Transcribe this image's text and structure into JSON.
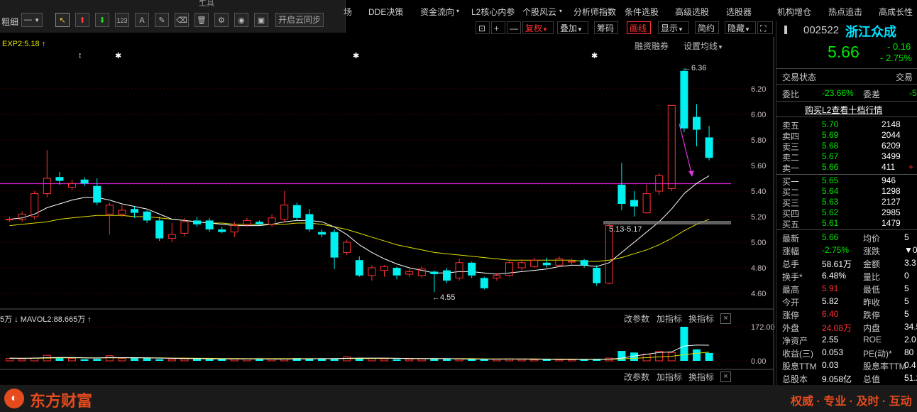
{
  "toolbar": {
    "window_title": "工具",
    "close": "×",
    "thickness_label": "粗细",
    "line_style": "—",
    "cloud_sync_label": "开启云同步",
    "num_icon_label": "123",
    "text_icon_label": "A"
  },
  "menu": [
    "场",
    "DDE决策",
    "资金流向",
    "L2核心内参",
    "个股风云",
    "分析师指数",
    "条件选股",
    "高级选股",
    "选股器",
    "机构增仓",
    "热点追击",
    "高成长性"
  ],
  "menu_dropdown_marks": [
    "▾",
    "▾",
    "▾"
  ],
  "chart_bar": {
    "plus": "+",
    "minus": "—",
    "fuquan": "复权",
    "dieja": "叠加",
    "chouma": "筹码",
    "huaxian": "画线",
    "xianshi": "显示",
    "jianyue": "简约",
    "yincang": "隐藏",
    "expand": "⛶"
  },
  "indicator_label": "EXP2:5.18 ↑",
  "rzrq_label": "融资融券",
  "ma_settings_label": "设置均线",
  "annotations": {
    "high": "←6.36",
    "low": "←4.55",
    "range_label": "5.13-5.17"
  },
  "volume_label": "5万 ↓ MAVOL2:88.665万 ↑",
  "vol_buttons": [
    "改参数",
    "加指标",
    "换指标"
  ],
  "vol_close": "×",
  "bottom_buttons": [
    "改参数",
    "加指标",
    "换指标"
  ],
  "chart_data": {
    "type": "candlestick",
    "y_ticks": [
      "6.20",
      "6.00",
      "5.80",
      "5.60",
      "5.40",
      "5.20",
      "5.00",
      "4.80",
      "4.60"
    ],
    "vol_ticks": [
      "172.00",
      "0.00"
    ],
    "ylim": [
      4.52,
      6.42
    ],
    "candles": [
      {
        "o": 5.18,
        "c": 5.18,
        "h": 5.2,
        "l": 5.16
      },
      {
        "o": 5.18,
        "c": 5.22,
        "h": 5.24,
        "l": 5.16
      },
      {
        "o": 5.2,
        "c": 5.38,
        "h": 5.4,
        "l": 5.18
      },
      {
        "o": 5.38,
        "c": 5.5,
        "h": 5.72,
        "l": 5.35
      },
      {
        "o": 5.51,
        "c": 5.48,
        "h": 5.55,
        "l": 5.45
      },
      {
        "o": 5.43,
        "c": 5.46,
        "h": 5.49,
        "l": 5.41
      },
      {
        "o": 5.49,
        "c": 5.46,
        "h": 5.51,
        "l": 5.44
      },
      {
        "o": 5.44,
        "c": 5.31,
        "h": 5.5,
        "l": 5.29
      },
      {
        "o": 5.22,
        "c": 5.29,
        "h": 5.31,
        "l": 5.06
      },
      {
        "o": 5.22,
        "c": 5.25,
        "h": 5.29,
        "l": 5.2
      },
      {
        "o": 5.26,
        "c": 5.23,
        "h": 5.28,
        "l": 5.19
      },
      {
        "o": 5.24,
        "c": 5.17,
        "h": 5.25,
        "l": 5.15
      },
      {
        "o": 5.17,
        "c": 5.03,
        "h": 5.2,
        "l": 5.01
      },
      {
        "o": 5.03,
        "c": 5.06,
        "h": 5.15,
        "l": 5.0
      },
      {
        "o": 5.07,
        "c": 5.16,
        "h": 5.19,
        "l": 5.05
      },
      {
        "o": 5.17,
        "c": 5.14,
        "h": 5.2,
        "l": 5.12
      },
      {
        "o": 5.17,
        "c": 5.1,
        "h": 5.19,
        "l": 5.08
      },
      {
        "o": 5.1,
        "c": 5.08,
        "h": 5.12,
        "l": 5.07
      },
      {
        "o": 5.08,
        "c": 5.13,
        "h": 5.16,
        "l": 5.04
      },
      {
        "o": 5.14,
        "c": 5.17,
        "h": 5.19,
        "l": 5.12
      },
      {
        "o": 5.16,
        "c": 5.14,
        "h": 5.17,
        "l": 5.13
      },
      {
        "o": 5.14,
        "c": 5.19,
        "h": 5.22,
        "l": 5.12
      },
      {
        "o": 5.18,
        "c": 5.29,
        "h": 5.4,
        "l": 5.16
      },
      {
        "o": 5.29,
        "c": 5.19,
        "h": 5.31,
        "l": 5.17
      },
      {
        "o": 5.22,
        "c": 5.1,
        "h": 5.26,
        "l": 5.08
      },
      {
        "o": 5.08,
        "c": 5.06,
        "h": 5.1,
        "l": 5.04
      },
      {
        "o": 5.08,
        "c": 4.88,
        "h": 5.1,
        "l": 4.79
      },
      {
        "o": 4.92,
        "c": 5.0,
        "h": 5.02,
        "l": 4.9
      },
      {
        "o": 4.86,
        "c": 4.74,
        "h": 4.89,
        "l": 4.73
      },
      {
        "o": 4.74,
        "c": 4.8,
        "h": 4.82,
        "l": 4.7
      },
      {
        "o": 4.78,
        "c": 4.81,
        "h": 4.82,
        "l": 4.73
      },
      {
        "o": 4.8,
        "c": 4.74,
        "h": 4.81,
        "l": 4.71
      },
      {
        "o": 4.75,
        "c": 4.77,
        "h": 4.79,
        "l": 4.73
      },
      {
        "o": 4.74,
        "c": 4.79,
        "h": 4.81,
        "l": 4.72
      },
      {
        "o": 4.77,
        "c": 4.75,
        "h": 4.78,
        "l": 4.61
      },
      {
        "o": 4.78,
        "c": 4.7,
        "h": 4.8,
        "l": 4.68
      },
      {
        "o": 4.72,
        "c": 4.84,
        "h": 4.87,
        "l": 4.7
      },
      {
        "o": 4.84,
        "c": 4.74,
        "h": 4.85,
        "l": 4.72
      },
      {
        "o": 4.72,
        "c": 4.64,
        "h": 4.73,
        "l": 4.63
      },
      {
        "o": 4.72,
        "c": 4.74,
        "h": 4.76,
        "l": 4.7
      },
      {
        "o": 4.74,
        "c": 4.84,
        "h": 4.85,
        "l": 4.73
      },
      {
        "o": 4.8,
        "c": 4.84,
        "h": 4.86,
        "l": 4.78
      },
      {
        "o": 4.81,
        "c": 4.86,
        "h": 4.88,
        "l": 4.8
      },
      {
        "o": 4.84,
        "c": 4.82,
        "h": 4.88,
        "l": 4.8
      },
      {
        "o": 4.82,
        "c": 4.87,
        "h": 4.89,
        "l": 4.81
      },
      {
        "o": 4.85,
        "c": 4.85,
        "h": 4.87,
        "l": 4.82
      },
      {
        "o": 4.86,
        "c": 4.82,
        "h": 4.87,
        "l": 4.8
      },
      {
        "o": 4.8,
        "c": 4.68,
        "h": 4.82,
        "l": 4.66
      },
      {
        "o": 4.68,
        "c": 5.13,
        "h": 5.15,
        "l": 4.67
      },
      {
        "o": 5.45,
        "c": 5.3,
        "h": 5.62,
        "l": 5.25
      },
      {
        "o": 5.33,
        "c": 5.28,
        "h": 5.4,
        "l": 5.2
      },
      {
        "o": 5.23,
        "c": 5.38,
        "h": 5.45,
        "l": 5.22
      },
      {
        "o": 5.4,
        "c": 5.52,
        "h": 5.54,
        "l": 5.37
      },
      {
        "o": 5.42,
        "c": 6.07,
        "h": 6.07,
        "l": 5.4
      },
      {
        "o": 6.34,
        "c": 5.89,
        "h": 6.36,
        "l": 5.86
      },
      {
        "o": 5.98,
        "c": 5.88,
        "h": 6.08,
        "l": 5.75
      },
      {
        "o": 5.82,
        "c": 5.66,
        "h": 5.91,
        "l": 5.64
      }
    ],
    "ma1": [
      5.18,
      5.19,
      5.22,
      5.27,
      5.3,
      5.33,
      5.35,
      5.35,
      5.33,
      5.3,
      5.28,
      5.26,
      5.22,
      5.18,
      5.17,
      5.16,
      5.15,
      5.14,
      5.13,
      5.13,
      5.13,
      5.14,
      5.16,
      5.17,
      5.17,
      5.16,
      5.12,
      5.06,
      4.98,
      4.92,
      4.87,
      4.83,
      4.8,
      4.78,
      4.76,
      4.76,
      4.77,
      4.77,
      4.76,
      4.75,
      4.76,
      4.77,
      4.78,
      4.79,
      4.81,
      4.82,
      4.82,
      4.81,
      4.84,
      4.92,
      5.0,
      5.08,
      5.16,
      5.26,
      5.38,
      5.46,
      5.52
    ],
    "ma2": [
      5.13,
      5.14,
      5.15,
      5.16,
      5.18,
      5.19,
      5.2,
      5.21,
      5.21,
      5.21,
      5.2,
      5.2,
      5.19,
      5.18,
      5.17,
      5.16,
      5.15,
      5.15,
      5.14,
      5.14,
      5.14,
      5.14,
      5.14,
      5.15,
      5.15,
      5.14,
      5.12,
      5.1,
      5.07,
      5.04,
      5.01,
      4.98,
      4.96,
      4.94,
      4.92,
      4.91,
      4.9,
      4.89,
      4.88,
      4.87,
      4.86,
      4.86,
      4.86,
      4.86,
      4.86,
      4.86,
      4.85,
      4.85,
      4.86,
      4.88,
      4.91,
      4.94,
      4.98,
      5.03,
      5.09,
      5.14,
      5.18
    ],
    "volumes": [
      12,
      10,
      14,
      28,
      14,
      12,
      8,
      10,
      26,
      12,
      16,
      14,
      8,
      8,
      10,
      12,
      8,
      10,
      9,
      10,
      8,
      9,
      10,
      14,
      10,
      12,
      9,
      20,
      14,
      12,
      10,
      8,
      9,
      10,
      12,
      10,
      9,
      8,
      7,
      8,
      10,
      8,
      6,
      7,
      6,
      6,
      7,
      10,
      14,
      50,
      42,
      34,
      48,
      42,
      172,
      58,
      40
    ],
    "vol_ma1": [
      14,
      13,
      14,
      16,
      17,
      17,
      15,
      14,
      17,
      16,
      16,
      15,
      14,
      13,
      12,
      11,
      10,
      10,
      10,
      10,
      10,
      9,
      9,
      10,
      10,
      11,
      11,
      13,
      14,
      14,
      14,
      13,
      12,
      11,
      11,
      11,
      10,
      9,
      9,
      9,
      9,
      9,
      8,
      8,
      7,
      7,
      7,
      7,
      8,
      14,
      24,
      33,
      42,
      45,
      75,
      80,
      79
    ],
    "vol_ma2": [
      13,
      13,
      13,
      14,
      15,
      15,
      15,
      15,
      15,
      15,
      15,
      15,
      15,
      14,
      14,
      13,
      13,
      12,
      12,
      11,
      11,
      11,
      11,
      11,
      11,
      11,
      11,
      12,
      12,
      12,
      13,
      13,
      12,
      12,
      12,
      11,
      11,
      11,
      10,
      10,
      10,
      10,
      10,
      9,
      9,
      9,
      8,
      8,
      8,
      10,
      13,
      16,
      20,
      23,
      32,
      38,
      44
    ],
    "markers": [
      "↕",
      "✱",
      "✱",
      "✱"
    ]
  },
  "stock": {
    "code": "002522",
    "name": "浙江众成",
    "price": "5.66",
    "change": "- 0.16",
    "change_pct": "- 2.75%",
    "status_label": "交易状态",
    "status_value": "交易",
    "weibi_label": "委比",
    "weibi": "-23.66%",
    "weicha_label": "委差",
    "weicha": "-5",
    "l2_link": "购买L2查看十档行情"
  },
  "asks": [
    {
      "label": "卖五",
      "price": "5.70",
      "vol": "2148"
    },
    {
      "label": "卖四",
      "price": "5.69",
      "vol": "2044"
    },
    {
      "label": "卖三",
      "price": "5.68",
      "vol": "6209"
    },
    {
      "label": "卖二",
      "price": "5.67",
      "vol": "3499"
    },
    {
      "label": "卖一",
      "price": "5.66",
      "vol": "411",
      "extra": "+"
    }
  ],
  "bids": [
    {
      "label": "买一",
      "price": "5.65",
      "vol": "946"
    },
    {
      "label": "买二",
      "price": "5.64",
      "vol": "1298"
    },
    {
      "label": "买三",
      "price": "5.63",
      "vol": "2127"
    },
    {
      "label": "买四",
      "price": "5.62",
      "vol": "2985"
    },
    {
      "label": "买五",
      "price": "5.61",
      "vol": "1479"
    }
  ],
  "quote": [
    {
      "l": "最新",
      "v": "5.66",
      "vc": "green",
      "l2": "均价",
      "v2": "5"
    },
    {
      "l": "涨幅",
      "v": "-2.75%",
      "vc": "green",
      "l2": "涨跌",
      "v2": "▼0"
    },
    {
      "l": "总手",
      "v": "58.61万",
      "vc": "white",
      "l2": "金额",
      "v2": "3.3"
    },
    {
      "l": "换手*",
      "v": "6.48%",
      "vc": "white",
      "l2": "量比",
      "v2": "0"
    },
    {
      "l": "最高",
      "v": "5.91",
      "vc": "red2",
      "l2": "最低",
      "v2": "5"
    },
    {
      "l": "今开",
      "v": "5.82",
      "vc": "white",
      "l2": "昨收",
      "v2": "5"
    },
    {
      "l": "涨停",
      "v": "6.40",
      "vc": "red2",
      "l2": "跌停",
      "v2": "5"
    },
    {
      "l": "外盘",
      "v": "24.08万",
      "vc": "red2",
      "l2": "内盘",
      "v2": "34.5"
    },
    {
      "l": "净资产",
      "v": "2.55",
      "vc": "white",
      "l2": "ROE",
      "v2": "2.0"
    },
    {
      "l": "收益(三)",
      "v": "0.053",
      "vc": "white",
      "l2": "PE(动)*",
      "v2": "80"
    },
    {
      "l": "股息TTM",
      "v": "0.03",
      "vc": "white",
      "l2": "股息率TTM",
      "v2": "0.4"
    },
    {
      "l": "总股本",
      "v": "9.058亿",
      "vc": "white",
      "l2": "总值",
      "v2": "51.2"
    }
  ],
  "footer": {
    "brand": "东方财富",
    "slogan": "权威 · 专业 · 及时 · 互动"
  },
  "colors": {
    "up": "#ff3232",
    "down": "#00f0f0",
    "ma1": "#ffffff",
    "ma2": "#e0e000",
    "hline": "#cc22cc",
    "brand": "#e64b1e"
  }
}
